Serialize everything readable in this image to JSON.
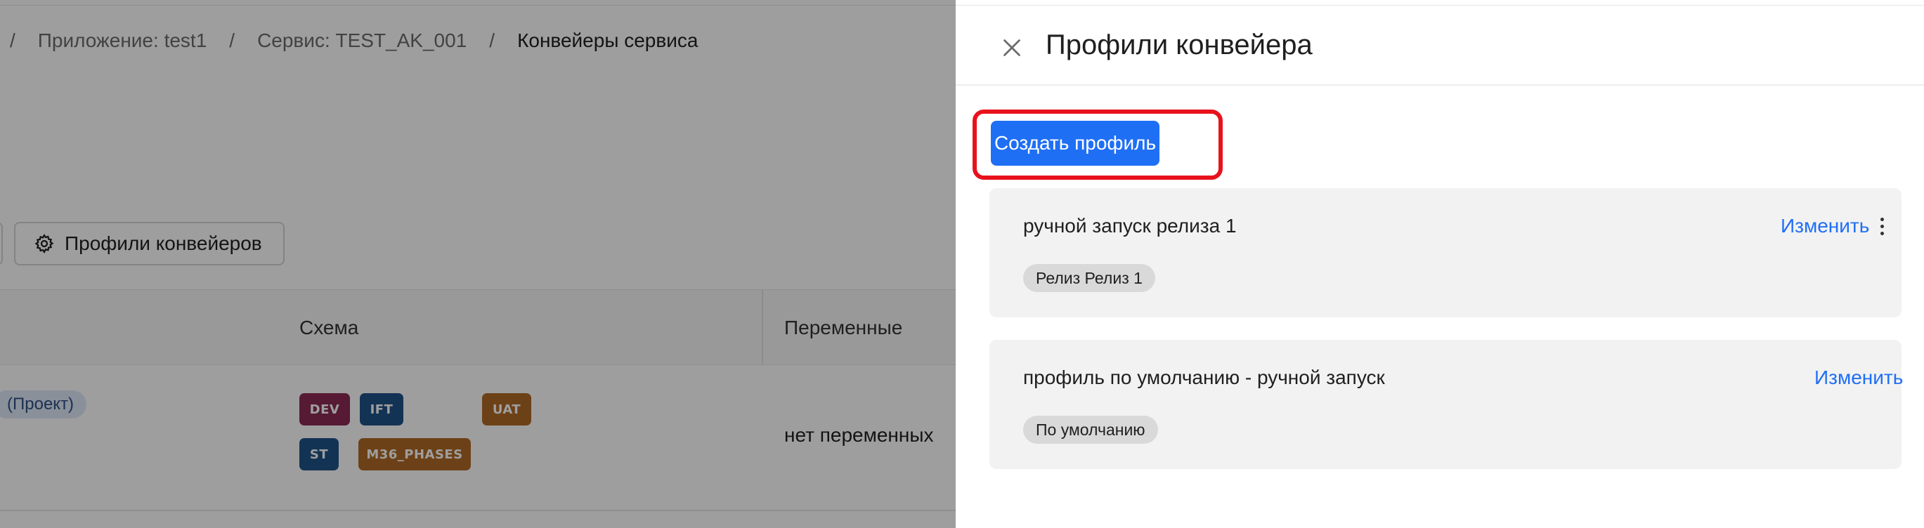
{
  "background": {
    "breadcrumb": {
      "separator": "/",
      "items": [
        "Приложение: test1",
        "Сервис: TEST_AK_001",
        "Конвейеры сервиса"
      ]
    },
    "profiles_button_label": "Профили конвейеров",
    "profiles_button_icon": "gear-icon",
    "table": {
      "columns": [
        "Схема",
        "Переменные"
      ],
      "row": {
        "project_tag": "(Проект)",
        "stages": [
          "DEV",
          "IFT",
          "UAT",
          "ST",
          "M36_PHASES"
        ],
        "variables": "нет переменных"
      }
    },
    "colors": {
      "stage_dev": "#8b2a55",
      "stage_ift": "#1f5388",
      "stage_uat": "#b06a26",
      "stage_st": "#1f5388",
      "stage_m36": "#b06a26"
    }
  },
  "drawer": {
    "title": "Профили конвейера",
    "close_icon": "close-icon",
    "create_button_label": "Создать профиль",
    "profiles": [
      {
        "name": "ручной запуск релиза 1",
        "edit_label": "Изменить",
        "tag": "Релиз Релиз 1",
        "has_menu": true
      },
      {
        "name": "профиль по умолчанию - ручной запуск",
        "edit_label": "Изменить",
        "tag": "По умолчанию",
        "has_menu": false
      }
    ],
    "colors": {
      "accent": "#1f6ff5",
      "highlight": "#e8121c"
    }
  }
}
